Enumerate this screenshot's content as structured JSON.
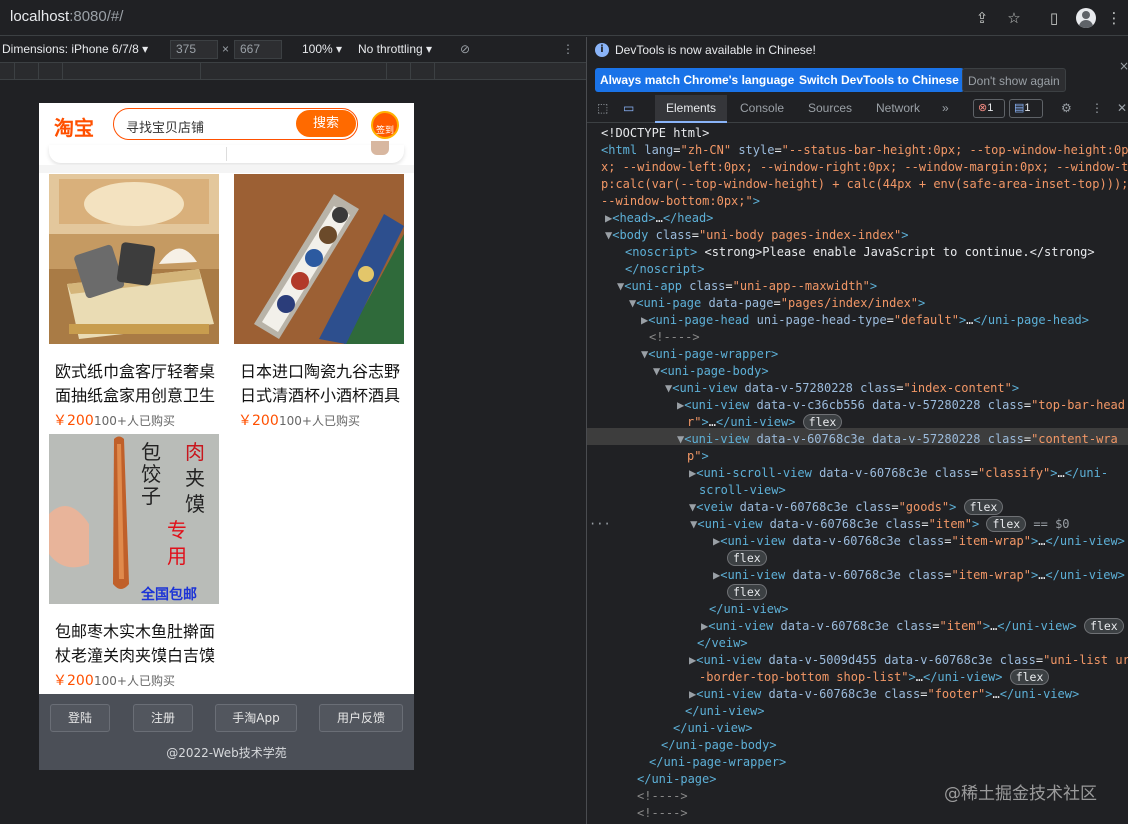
{
  "browser": {
    "url_host": "localhost",
    "url_rest": ":8080/#/"
  },
  "emulation": {
    "dimensions_label": "Dimensions: iPhone 6/7/8",
    "width": "375",
    "times": "×",
    "height": "667",
    "zoom": "100%",
    "throttling": "No throttling"
  },
  "app": {
    "logo": "淘宝",
    "search_placeholder": "寻找宝贝店铺",
    "search_button": "搜索",
    "badge_label": "签到",
    "products": [
      {
        "title": "欧式纸巾盒客厅轻奢桌面抽纸盒家用创意卫生",
        "price": "￥200",
        "sold": "100+人已购买"
      },
      {
        "title": "日本进口陶瓷九谷志野日式清酒杯小酒杯酒具",
        "price": "￥200",
        "sold": "100+人已购买"
      },
      {
        "title": "包邮枣木实木鱼肚擀面杖老潼关肉夹馍白吉馍",
        "price": "￥200",
        "sold": "100+人已购买"
      }
    ],
    "product3_overlay": {
      "t1": "包",
      "t2": "饺",
      "t3": "子",
      "t4": "肉",
      "t5": "夹",
      "t6": "馍",
      "t7": "专",
      "t8": "用",
      "t9": "全国包邮"
    },
    "footer": {
      "buttons": [
        "登陆",
        "注册",
        "手淘App",
        "用户反馈"
      ],
      "copyright": "@2022-Web技术学苑"
    }
  },
  "devtools": {
    "notice": "DevTools is now available in Chinese!",
    "btn_match": "Always match Chrome's language",
    "btn_switch": "Switch DevTools to Chinese",
    "btn_dont": "Don't show again",
    "tabs": [
      "Elements",
      "Console",
      "Sources",
      "Network"
    ],
    "more": "»",
    "error_count": "1",
    "msg_count": "1",
    "code_lines": [
      "<!DOCTYPE html>"
    ],
    "selected_suffix": "== $0"
  },
  "watermark": "@稀土掘金技术社区"
}
